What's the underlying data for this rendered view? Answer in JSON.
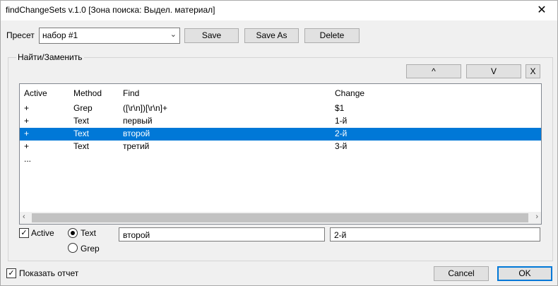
{
  "window": {
    "title": "findChangeSets v.1.0 [Зона поиска: Выдел. материал]",
    "close_icon": "close-icon"
  },
  "preset": {
    "label": "Пресет",
    "value": "набор #1",
    "save": "Save",
    "save_as": "Save As",
    "delete": "Delete"
  },
  "group": {
    "label": "Найти/Заменить",
    "up": "^",
    "down": "V",
    "remove": "X"
  },
  "table": {
    "columns": [
      "Active",
      "Method",
      "Find",
      "Change"
    ],
    "rows": [
      {
        "active": "+",
        "method": "Grep",
        "find": "([\\r\\n])[\\r\\n]+",
        "change": "$1"
      },
      {
        "active": "+",
        "method": "Text",
        "find": "первый",
        "change": "1-й"
      },
      {
        "active": "+",
        "method": "Text",
        "find": "второй",
        "change": "2-й"
      },
      {
        "active": "+",
        "method": "Text",
        "find": "третий",
        "change": "3-й"
      },
      {
        "active": "...",
        "method": "",
        "find": "",
        "change": ""
      }
    ],
    "selected_index": 2
  },
  "editor": {
    "active_label": "Active",
    "active_checked": true,
    "text_label": "Text",
    "grep_label": "Grep",
    "mode": "Text",
    "find_value": "второй",
    "change_value": "2-й"
  },
  "footer": {
    "report_label": "Показать отчет",
    "report_checked": true,
    "cancel": "Cancel",
    "ok": "OK"
  },
  "colors": {
    "selection": "#0078d7",
    "ok_border": "#0078d7"
  }
}
